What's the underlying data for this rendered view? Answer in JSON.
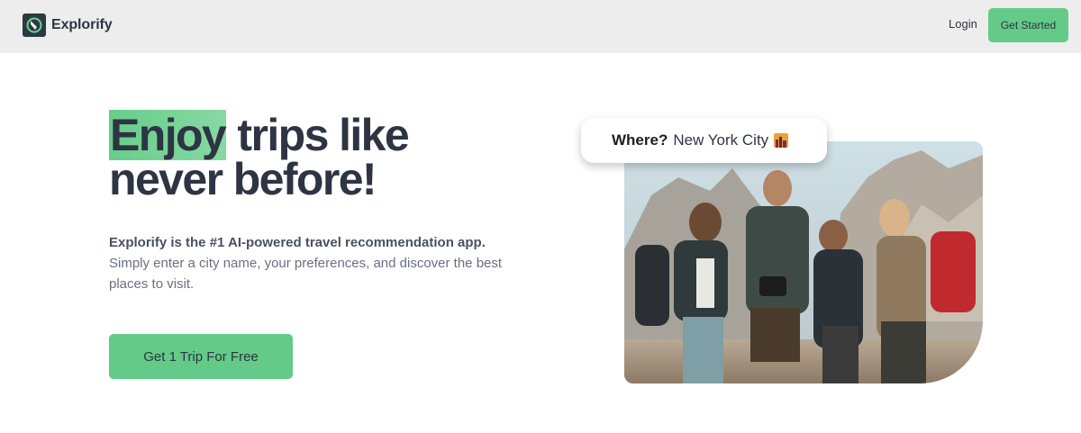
{
  "header": {
    "brand_name": "Explorify",
    "login_label": "Login",
    "get_started_label": "Get Started"
  },
  "hero": {
    "headline_highlight": "Enjoy",
    "headline_rest_1": " trips like",
    "headline_line_2": "never before!",
    "lead_bold": "Explorify is the #1 AI-powered travel recommendation app.",
    "lead_text": "Simply enter a city name, your preferences, and discover the best places to visit.",
    "cta_label": "Get 1 Trip For Free"
  },
  "search_chip": {
    "label": "Where?",
    "city": "New York City"
  },
  "colors": {
    "accent": "#63cb87",
    "header_bg": "#ededed",
    "text_dark": "#2e3443"
  },
  "icons": {
    "logo": "globe-logo-icon",
    "city_emoji": "cityscape-icon",
    "photo": "travelers-photo"
  }
}
